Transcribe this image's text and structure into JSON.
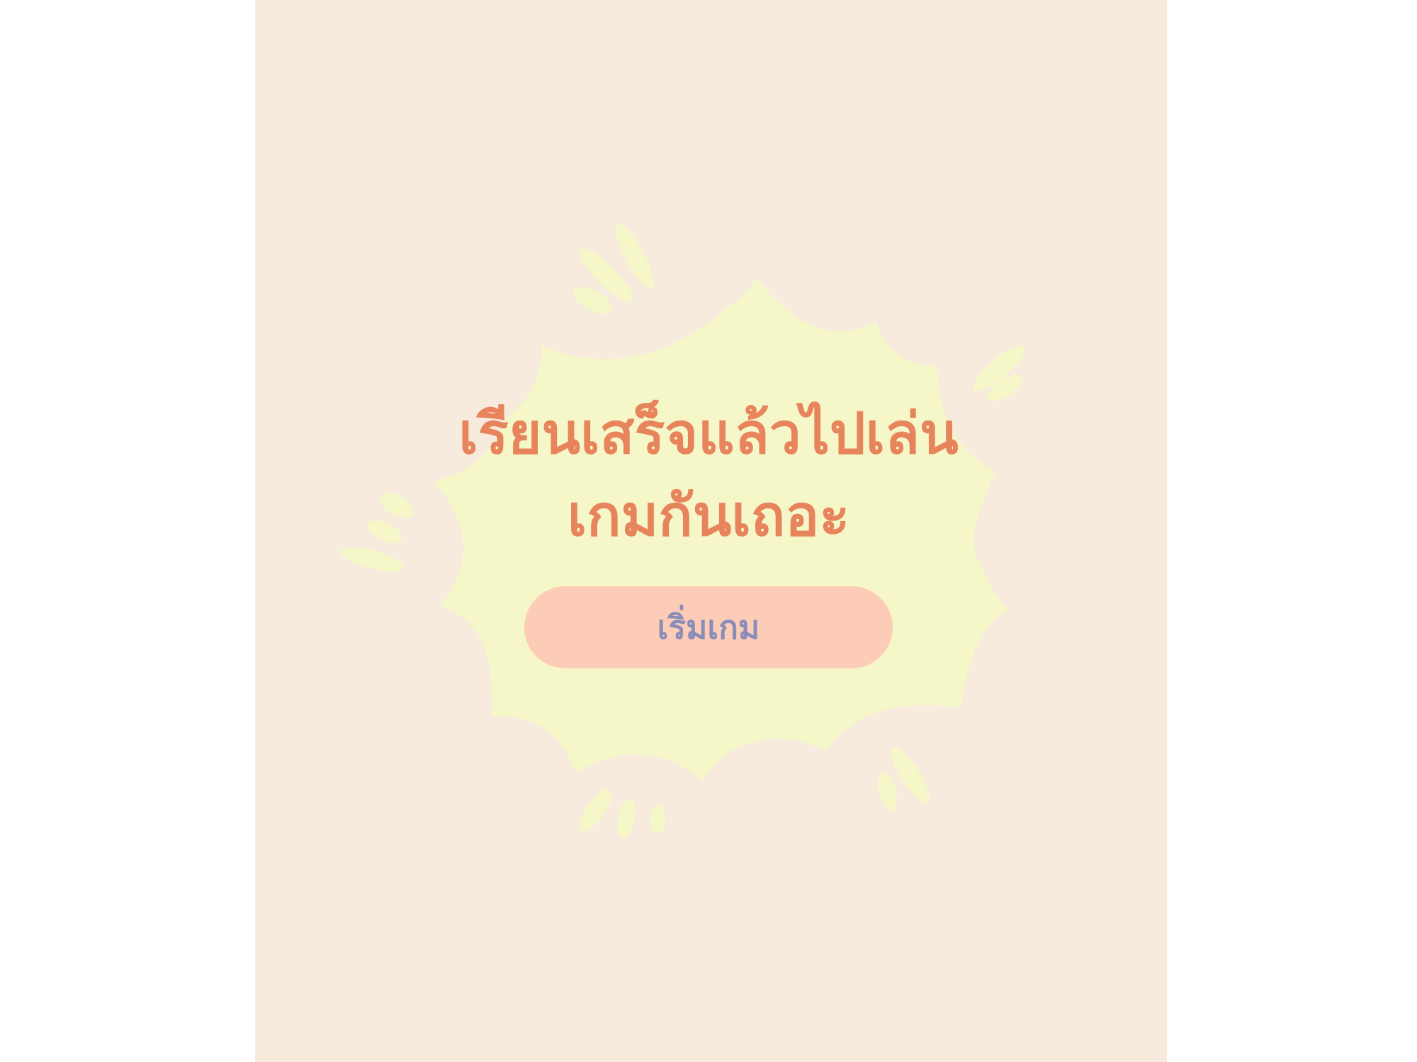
{
  "screen": {
    "title_line_1": "เรียนเสร็จแล้วไปเล่น",
    "title_line_2": "เกมกันเถอะ",
    "start_button_label": "เริ่มเกม"
  },
  "colors": {
    "page_background": "#ffffff",
    "panel_background": "#f6ebdc",
    "burst_fill": "#f5f7c8",
    "title_text": "#e8845c",
    "button_fill": "#fdccb7",
    "button_text": "#8a8db8"
  },
  "icons": [
    "starburst-icon",
    "sparkle-dash-icon"
  ]
}
